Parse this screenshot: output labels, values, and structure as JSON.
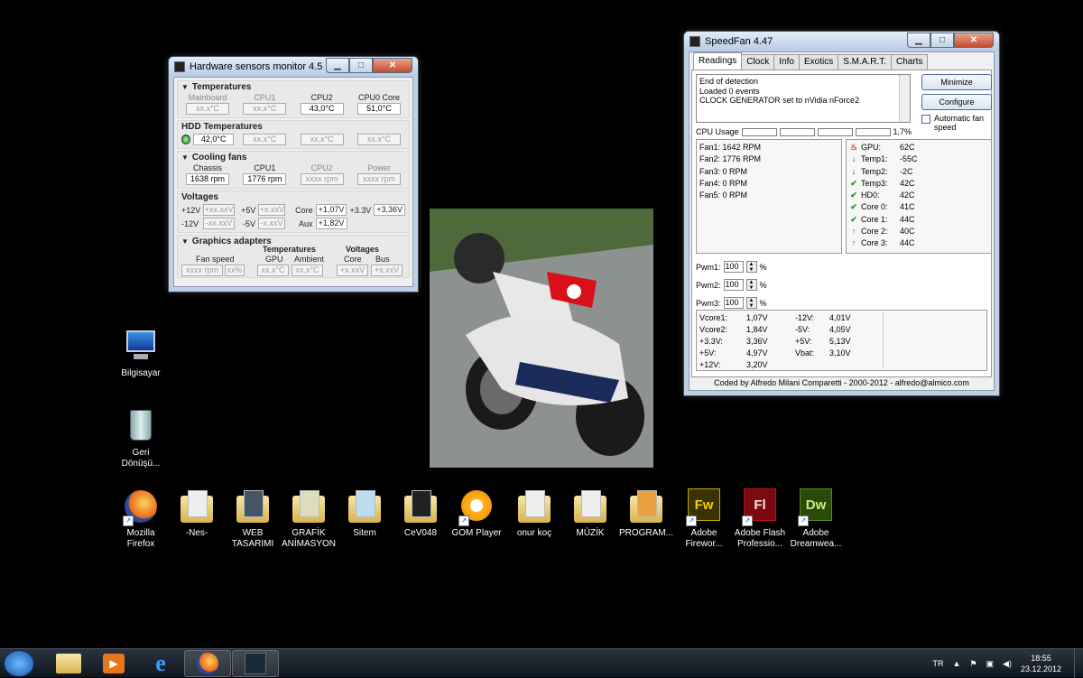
{
  "hws": {
    "title": "Hardware sensors monitor 4.5",
    "temps": {
      "header": "Temperatures",
      "cols": [
        {
          "label": "Mainboard",
          "value": "xx.x°C",
          "dim": true
        },
        {
          "label": "CPU1",
          "value": "xx.x°C",
          "dim": true
        },
        {
          "label": "CPU2",
          "value": "43,0°C",
          "dim": false
        },
        {
          "label": "CPU0 Core",
          "value": "51,0°C",
          "dim": false
        }
      ]
    },
    "hdd": {
      "header": "HDD Temperatures",
      "values": [
        "42,0°C",
        "xx.x°C",
        "xx.x°C",
        "xx.x°C"
      ]
    },
    "fans": {
      "header": "Cooling fans",
      "cols": [
        {
          "label": "Chassis",
          "value": "1638 rpm",
          "dim": false
        },
        {
          "label": "CPU1",
          "value": "1776 rpm",
          "dim": false
        },
        {
          "label": "CPU2",
          "value": "xxxx rpm",
          "dim": true
        },
        {
          "label": "Power",
          "value": "xxxx rpm",
          "dim": true
        }
      ]
    },
    "voltages": {
      "header": "Voltages",
      "r1": {
        "l1": "+12V",
        "v1": "+xx.xxV",
        "l2": "+5V",
        "v2": "+x.xxV",
        "l3": "Core",
        "v3": "+1,07V",
        "l4": "+3.3V",
        "v4": "+3,36V"
      },
      "r2": {
        "l1": "-12V",
        "v1": "-xx.xxV",
        "l2": "-5V",
        "v2": "-x.xxV",
        "l3": "Aux",
        "v3": "+1,82V"
      }
    },
    "gfx": {
      "header": "Graphics adapters",
      "temps_label": "Temperatures",
      "volts_label": "Voltages",
      "fan_label": "Fan speed",
      "gpu_label": "GPU",
      "amb_label": "Ambient",
      "core_label": "Core",
      "bus_label": "Bus",
      "fan_rpm": "xxxx rpm",
      "fan_pct": "xx%",
      "gpu": "xx.x°C",
      "amb": "xx.x°C",
      "core": "+x.xxV",
      "bus": "+x.xxV"
    }
  },
  "sf": {
    "title": "SpeedFan 4.47",
    "tabs": [
      "Readings",
      "Clock",
      "Info",
      "Exotics",
      "S.M.A.R.T.",
      "Charts"
    ],
    "log": [
      "End of detection",
      "Loaded 0 events",
      "CLOCK GENERATOR set to nVidia nForce2"
    ],
    "minimize": "Minimize",
    "configure": "Configure",
    "auto_fan": "Automatic fan speed",
    "cpu_usage": "CPU Usage",
    "cpu_pct": "1,7%",
    "fans": [
      "Fan1: 1642 RPM",
      "Fan2: 1776 RPM",
      "Fan3: 0 RPM",
      "Fan4: 0 RPM",
      "Fan5: 0 RPM"
    ],
    "temps": [
      {
        "icon": "flame-icon",
        "label": "GPU:",
        "value": "62C",
        "color": "#d83c1a"
      },
      {
        "icon": "arrow-down-icon",
        "label": "Temp1:",
        "value": "-55C",
        "color": "#1440c8"
      },
      {
        "icon": "arrow-down-icon",
        "label": "Temp2:",
        "value": "-2C",
        "color": "#1440c8"
      },
      {
        "icon": "check-icon",
        "label": "Temp3:",
        "value": "42C",
        "color": "#1c9a1c"
      },
      {
        "icon": "check-icon",
        "label": "HD0:",
        "value": "42C",
        "color": "#1c9a1c"
      },
      {
        "icon": "check-icon",
        "label": "Core 0:",
        "value": "41C",
        "color": "#1c9a1c"
      },
      {
        "icon": "check-icon",
        "label": "Core 1:",
        "value": "44C",
        "color": "#1c9a1c"
      },
      {
        "icon": "arrow-up-icon",
        "label": "Core 2:",
        "value": "40C",
        "color": "#d81a1a"
      },
      {
        "icon": "arrow-up-icon",
        "label": "Core 3:",
        "value": "44C",
        "color": "#d81a1a"
      }
    ],
    "pwm": [
      {
        "label": "Pwm1:",
        "value": "100",
        "unit": "%"
      },
      {
        "label": "Pwm2:",
        "value": "100",
        "unit": "%"
      },
      {
        "label": "Pwm3:",
        "value": "100",
        "unit": "%"
      }
    ],
    "volts_left": [
      [
        "Vcore1:",
        "1,07V"
      ],
      [
        "Vcore2:",
        "1,84V"
      ],
      [
        "+3.3V:",
        "3,36V"
      ],
      [
        "+5V:",
        "4,97V"
      ],
      [
        "+12V:",
        "3,20V"
      ]
    ],
    "volts_right": [
      [
        "-12V:",
        "4,01V"
      ],
      [
        "-5V:",
        "4,05V"
      ],
      [
        "+5V:",
        "5,13V"
      ],
      [
        "Vbat:",
        "3,10V"
      ]
    ],
    "footer": "Coded by Alfredo Milani Comparetti - 2000-2012 - alfredo@almico.com"
  },
  "desktop": {
    "icons_left": [
      {
        "label": "Bilgisayar"
      },
      {
        "label": "Geri Dönüşü..."
      }
    ],
    "icons_row": [
      {
        "label": "Mozilla Firefox"
      },
      {
        "label": "-Nes-"
      },
      {
        "label": "WEB TASARIMI"
      },
      {
        "label": "GRAFİK ANİMASYON"
      },
      {
        "label": "Sitem"
      },
      {
        "label": "CeV048"
      },
      {
        "label": "GOM Player"
      },
      {
        "label": "onur koç"
      },
      {
        "label": "MÜZİK"
      },
      {
        "label": "PROGRAM..."
      },
      {
        "label": "Adobe Firewor...",
        "badge": "Fw"
      },
      {
        "label": "Adobe Flash Professio...",
        "badge": "Fl"
      },
      {
        "label": "Adobe Dreamwea...",
        "badge": "Dw"
      }
    ]
  },
  "taskbar": {
    "lang": "TR",
    "time": "18:55",
    "date": "23.12.2012"
  },
  "colors": {
    "fw": "#c8a800",
    "fl": "#b8101a",
    "dw": "#5a8a1a"
  }
}
